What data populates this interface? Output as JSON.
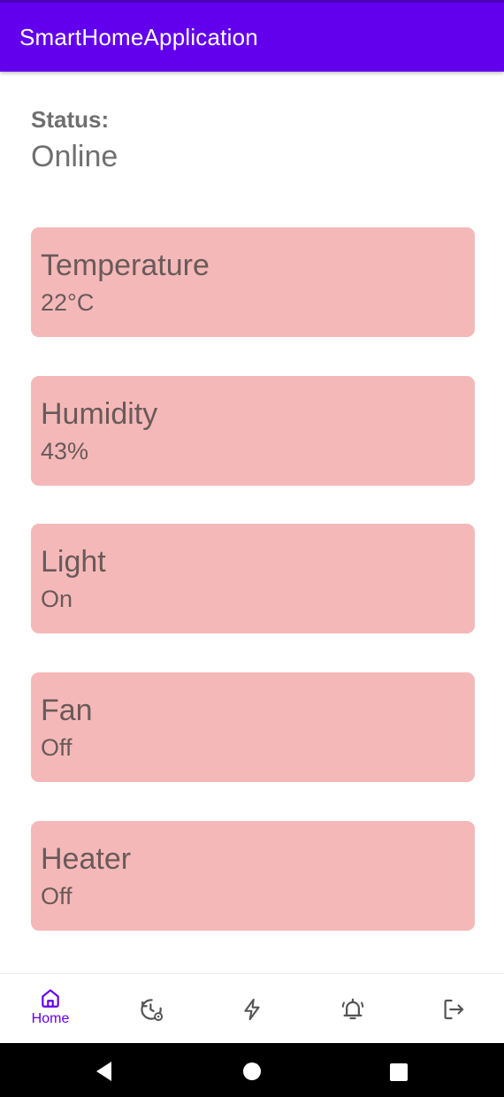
{
  "app": {
    "title": "SmartHomeApplication"
  },
  "status": {
    "label": "Status:",
    "value": "Online"
  },
  "devices": [
    {
      "name": "Temperature",
      "value": "22°C"
    },
    {
      "name": "Humidity",
      "value": "43%"
    },
    {
      "name": "Light",
      "value": "On"
    },
    {
      "name": "Fan",
      "value": "Off"
    },
    {
      "name": "Heater",
      "value": "Off"
    }
  ],
  "bottom_nav": {
    "items": [
      {
        "label": "Home",
        "icon": "home-icon",
        "active": true
      },
      {
        "label": "",
        "icon": "history-settings-icon",
        "active": false
      },
      {
        "label": "",
        "icon": "lightning-icon",
        "active": false
      },
      {
        "label": "",
        "icon": "alarm-bell-icon",
        "active": false
      },
      {
        "label": "",
        "icon": "logout-icon",
        "active": false
      }
    ]
  },
  "colors": {
    "primary": "#6200EE",
    "card": "#f5b8b8",
    "text_secondary": "#6f6f6f",
    "nav_inactive": "#555555"
  },
  "system_nav": {
    "buttons": [
      "back",
      "home",
      "recents"
    ]
  }
}
